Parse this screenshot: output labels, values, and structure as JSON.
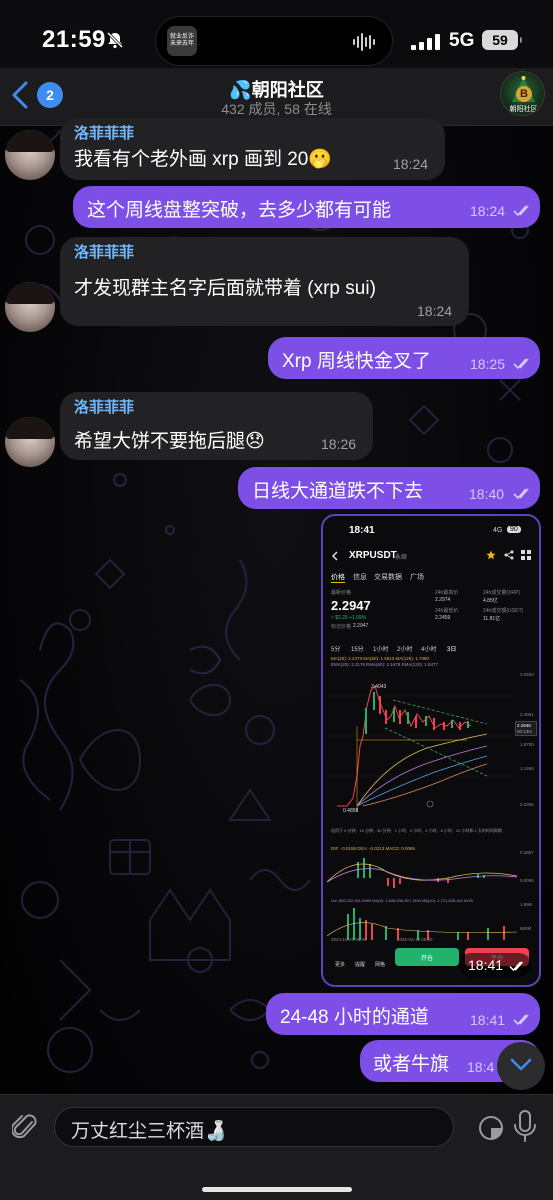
{
  "status_bar": {
    "time": "21:59",
    "bell_icon": "bell-slash-icon",
    "island_caption": "就业反诈 未来去年",
    "network": "5G",
    "battery": "59"
  },
  "header": {
    "back_count": "2",
    "title": "💦朝阳社区",
    "subtitle": "432 成员, 58 在线",
    "avatar_caption": "朝阳社区",
    "avatar_symbol": "B"
  },
  "messages": [
    {
      "id": "m1",
      "direction": "in",
      "sender": "洛菲菲菲",
      "text": "我看有个老外画 xrp 画到 20🫢",
      "time": "18:24"
    },
    {
      "id": "m2",
      "direction": "out",
      "text": "这个周线盘整突破，去多少都有可能",
      "time": "18:24"
    },
    {
      "id": "m3",
      "direction": "in",
      "sender": "洛菲菲菲",
      "text": "才发现群主名字后面就带着 (xrp sui)",
      "time": "18:24"
    },
    {
      "id": "m4",
      "direction": "out",
      "text": "Xrp 周线快金叉了",
      "time": "18:25"
    },
    {
      "id": "m5",
      "direction": "in",
      "sender": "洛菲菲菲",
      "text": "希望大饼不要拖后腿😞",
      "time": "18:26"
    },
    {
      "id": "m6",
      "direction": "out",
      "text": "日线大通道跌不下去",
      "time": "18:40"
    },
    {
      "id": "m7",
      "direction": "out",
      "type": "image",
      "time": "18:41"
    },
    {
      "id": "m8",
      "direction": "out",
      "text": "24-48 小时的通道",
      "time": "18:41"
    },
    {
      "id": "m9",
      "direction": "out",
      "text": "或者牛旗",
      "time": "18:4"
    }
  ],
  "screenshot": {
    "time": "18:41",
    "network": "4G",
    "battery": "90",
    "pair": "XRPUSDT",
    "pair_suffix": "永续",
    "tabs": [
      "价格",
      "信息",
      "交易数据",
      "广场"
    ],
    "last_price_label": "最新价格",
    "price": "2.2947",
    "change": "≈ $2.29  +1.09%",
    "mark_label": "标记价格",
    "mark": "2.2947",
    "stats": [
      {
        "label": "24h最高价",
        "value": "2.2974"
      },
      {
        "label": "24h成交量(XRP)",
        "value": "4.85亿"
      },
      {
        "label": "24h最低价",
        "value": "2.2459"
      },
      {
        "label": "24h成交额(USDT)",
        "value": "11.81亿"
      }
    ],
    "intervals": [
      "5分",
      "15分",
      "1小时",
      "2小时",
      "4小时",
      "3日"
    ],
    "ma_line": "MA(20): 2.2473  MA(60): 1.5813  MA(120): 1.7380",
    "ema_line": "EMA(20): 2.2176  EMA(60): 2.1679  EMA(120): 1.8477",
    "price_axis": [
      "3.0503",
      "2.4851",
      "1.8700",
      "1.1466",
      "0.3395"
    ],
    "peak_label": "3.4043",
    "low_label": "0.4858",
    "tag_price": "2.2948",
    "tag_time": "00:13m",
    "note": "适用于 5 分钟、15 分钟、30 分钟、1 小时、2 小时、4 小时、6 小时、12 小时和 1 天的时间周期",
    "macd_line": "DIF: -0.0159  DEA: -0.0213  MACD: 0.0065",
    "macd_axis": [
      "0.4857",
      "0.0095"
    ],
    "vol_line": "Vol: 808,232,301.6989  MA(5): 1,698,536,367.1399  MA(10): 1,721,628,162.8199",
    "vol_axis": [
      "1.99B",
      "868M"
    ],
    "dates": [
      "2024-10-29 08:00",
      "2025-03-18 08:00"
    ],
    "bottom_icons": [
      "更多",
      "提醒",
      "网格"
    ],
    "buy_label": "开仓",
    "sell_label": "平仓",
    "colors": {
      "up": "#23b26d",
      "down": "#f0424e",
      "accent": "#f0b90b"
    }
  },
  "input": {
    "placeholder_value": "万丈红尘三杯酒🍶",
    "attach_icon": "paperclip-icon",
    "sticker_icon": "sticker-icon",
    "mic_icon": "microphone-icon"
  },
  "colors": {
    "outgoing_bubble": "#7d4fe6",
    "incoming_bubble": "#222224",
    "sender_name": "#6fb7ff",
    "accent_blue": "#3f8cf0"
  }
}
